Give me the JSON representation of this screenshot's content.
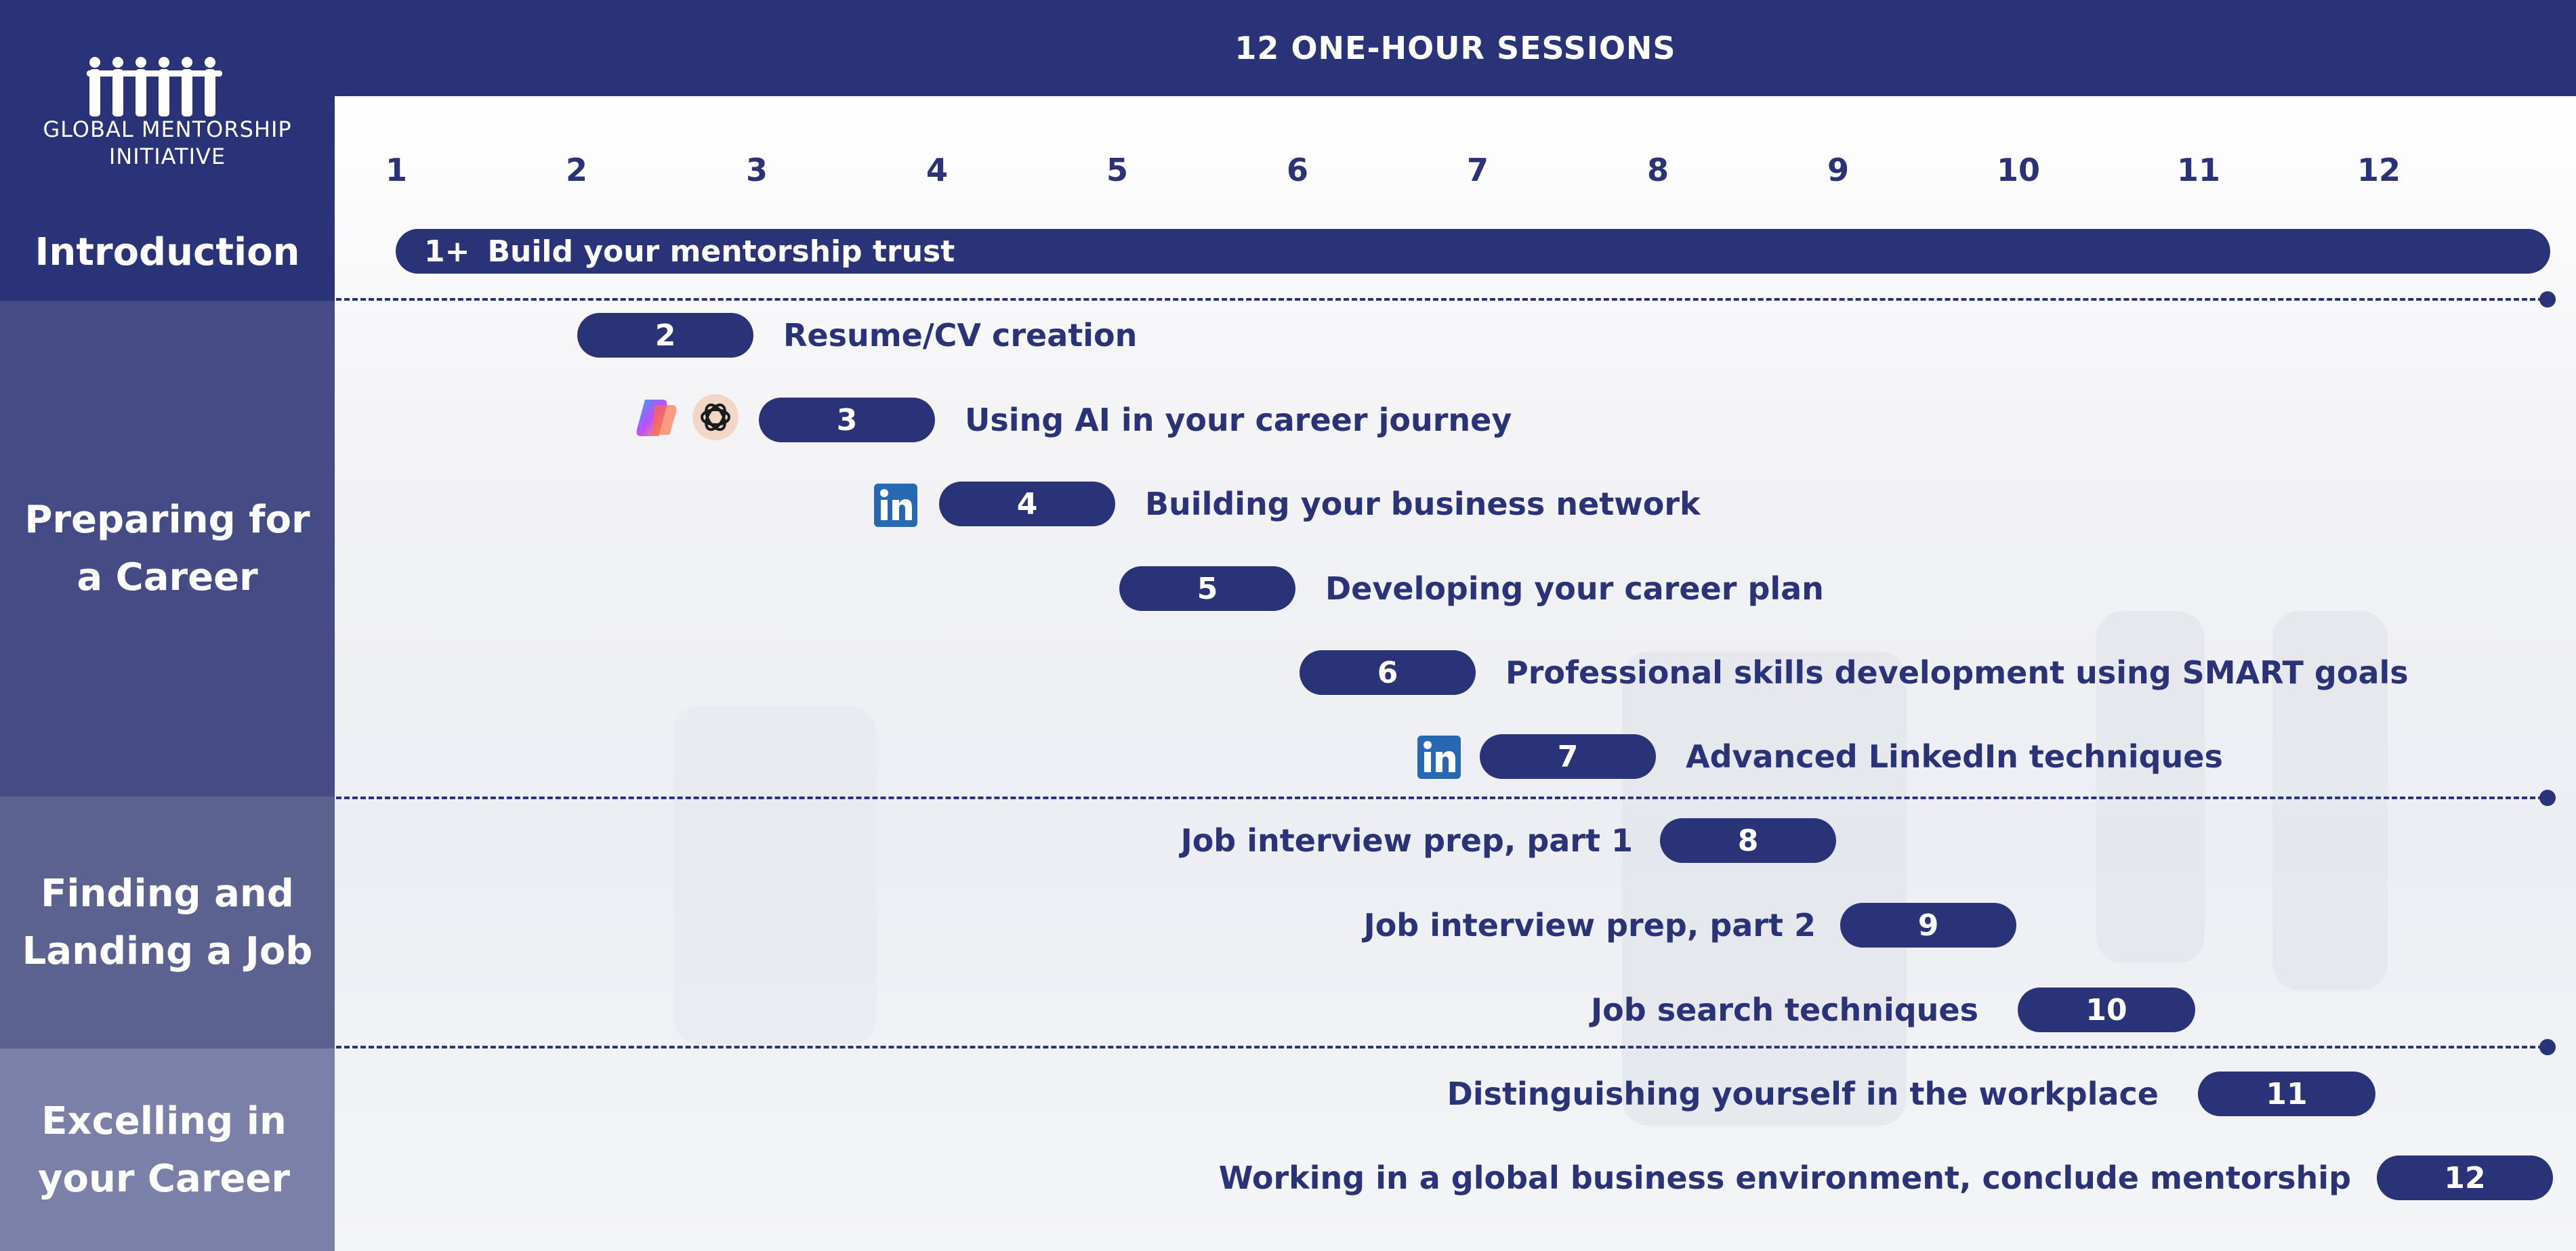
{
  "header": {
    "title": "12 ONE-HOUR SESSIONS"
  },
  "logo": {
    "line1": "GLOBAL MENTORSHIP",
    "line2": "INITIATIVE"
  },
  "phases": [
    {
      "label": "Introduction",
      "color": "#2a3278"
    },
    {
      "label": "Preparing for a Career",
      "color": "#454c85"
    },
    {
      "label": "Finding and Landing a Job",
      "color": "#5b628f"
    },
    {
      "label": "Excelling in your Career",
      "color": "#7b80a8"
    }
  ],
  "session_numbers": [
    "1",
    "2",
    "3",
    "4",
    "5",
    "6",
    "7",
    "8",
    "9",
    "10",
    "11",
    "12"
  ],
  "sessions": [
    {
      "number": "1+",
      "title": "Build your mentorship trust"
    },
    {
      "number": "2",
      "title": "Resume/CV creation"
    },
    {
      "number": "3",
      "title": "Using AI in your career journey",
      "icons": [
        "copilot-icon",
        "chatgpt-icon"
      ]
    },
    {
      "number": "4",
      "title": "Building your business network",
      "icons": [
        "linkedin-icon"
      ]
    },
    {
      "number": "5",
      "title": "Developing your career plan"
    },
    {
      "number": "6",
      "title": "Professional skills development using SMART goals"
    },
    {
      "number": "7",
      "title": "Advanced LinkedIn techniques",
      "icons": [
        "linkedin-icon"
      ]
    },
    {
      "number": "8",
      "title": "Job interview prep, part 1"
    },
    {
      "number": "9",
      "title": "Job interview prep, part 2"
    },
    {
      "number": "10",
      "title": "Job search techniques"
    },
    {
      "number": "11",
      "title": "Distinguishing yourself in the workplace"
    },
    {
      "number": "12",
      "title": "Working in a global business environment, conclude mentorship"
    }
  ],
  "colors": {
    "primary": "#2a3278",
    "linkedin": "#2867b2"
  }
}
